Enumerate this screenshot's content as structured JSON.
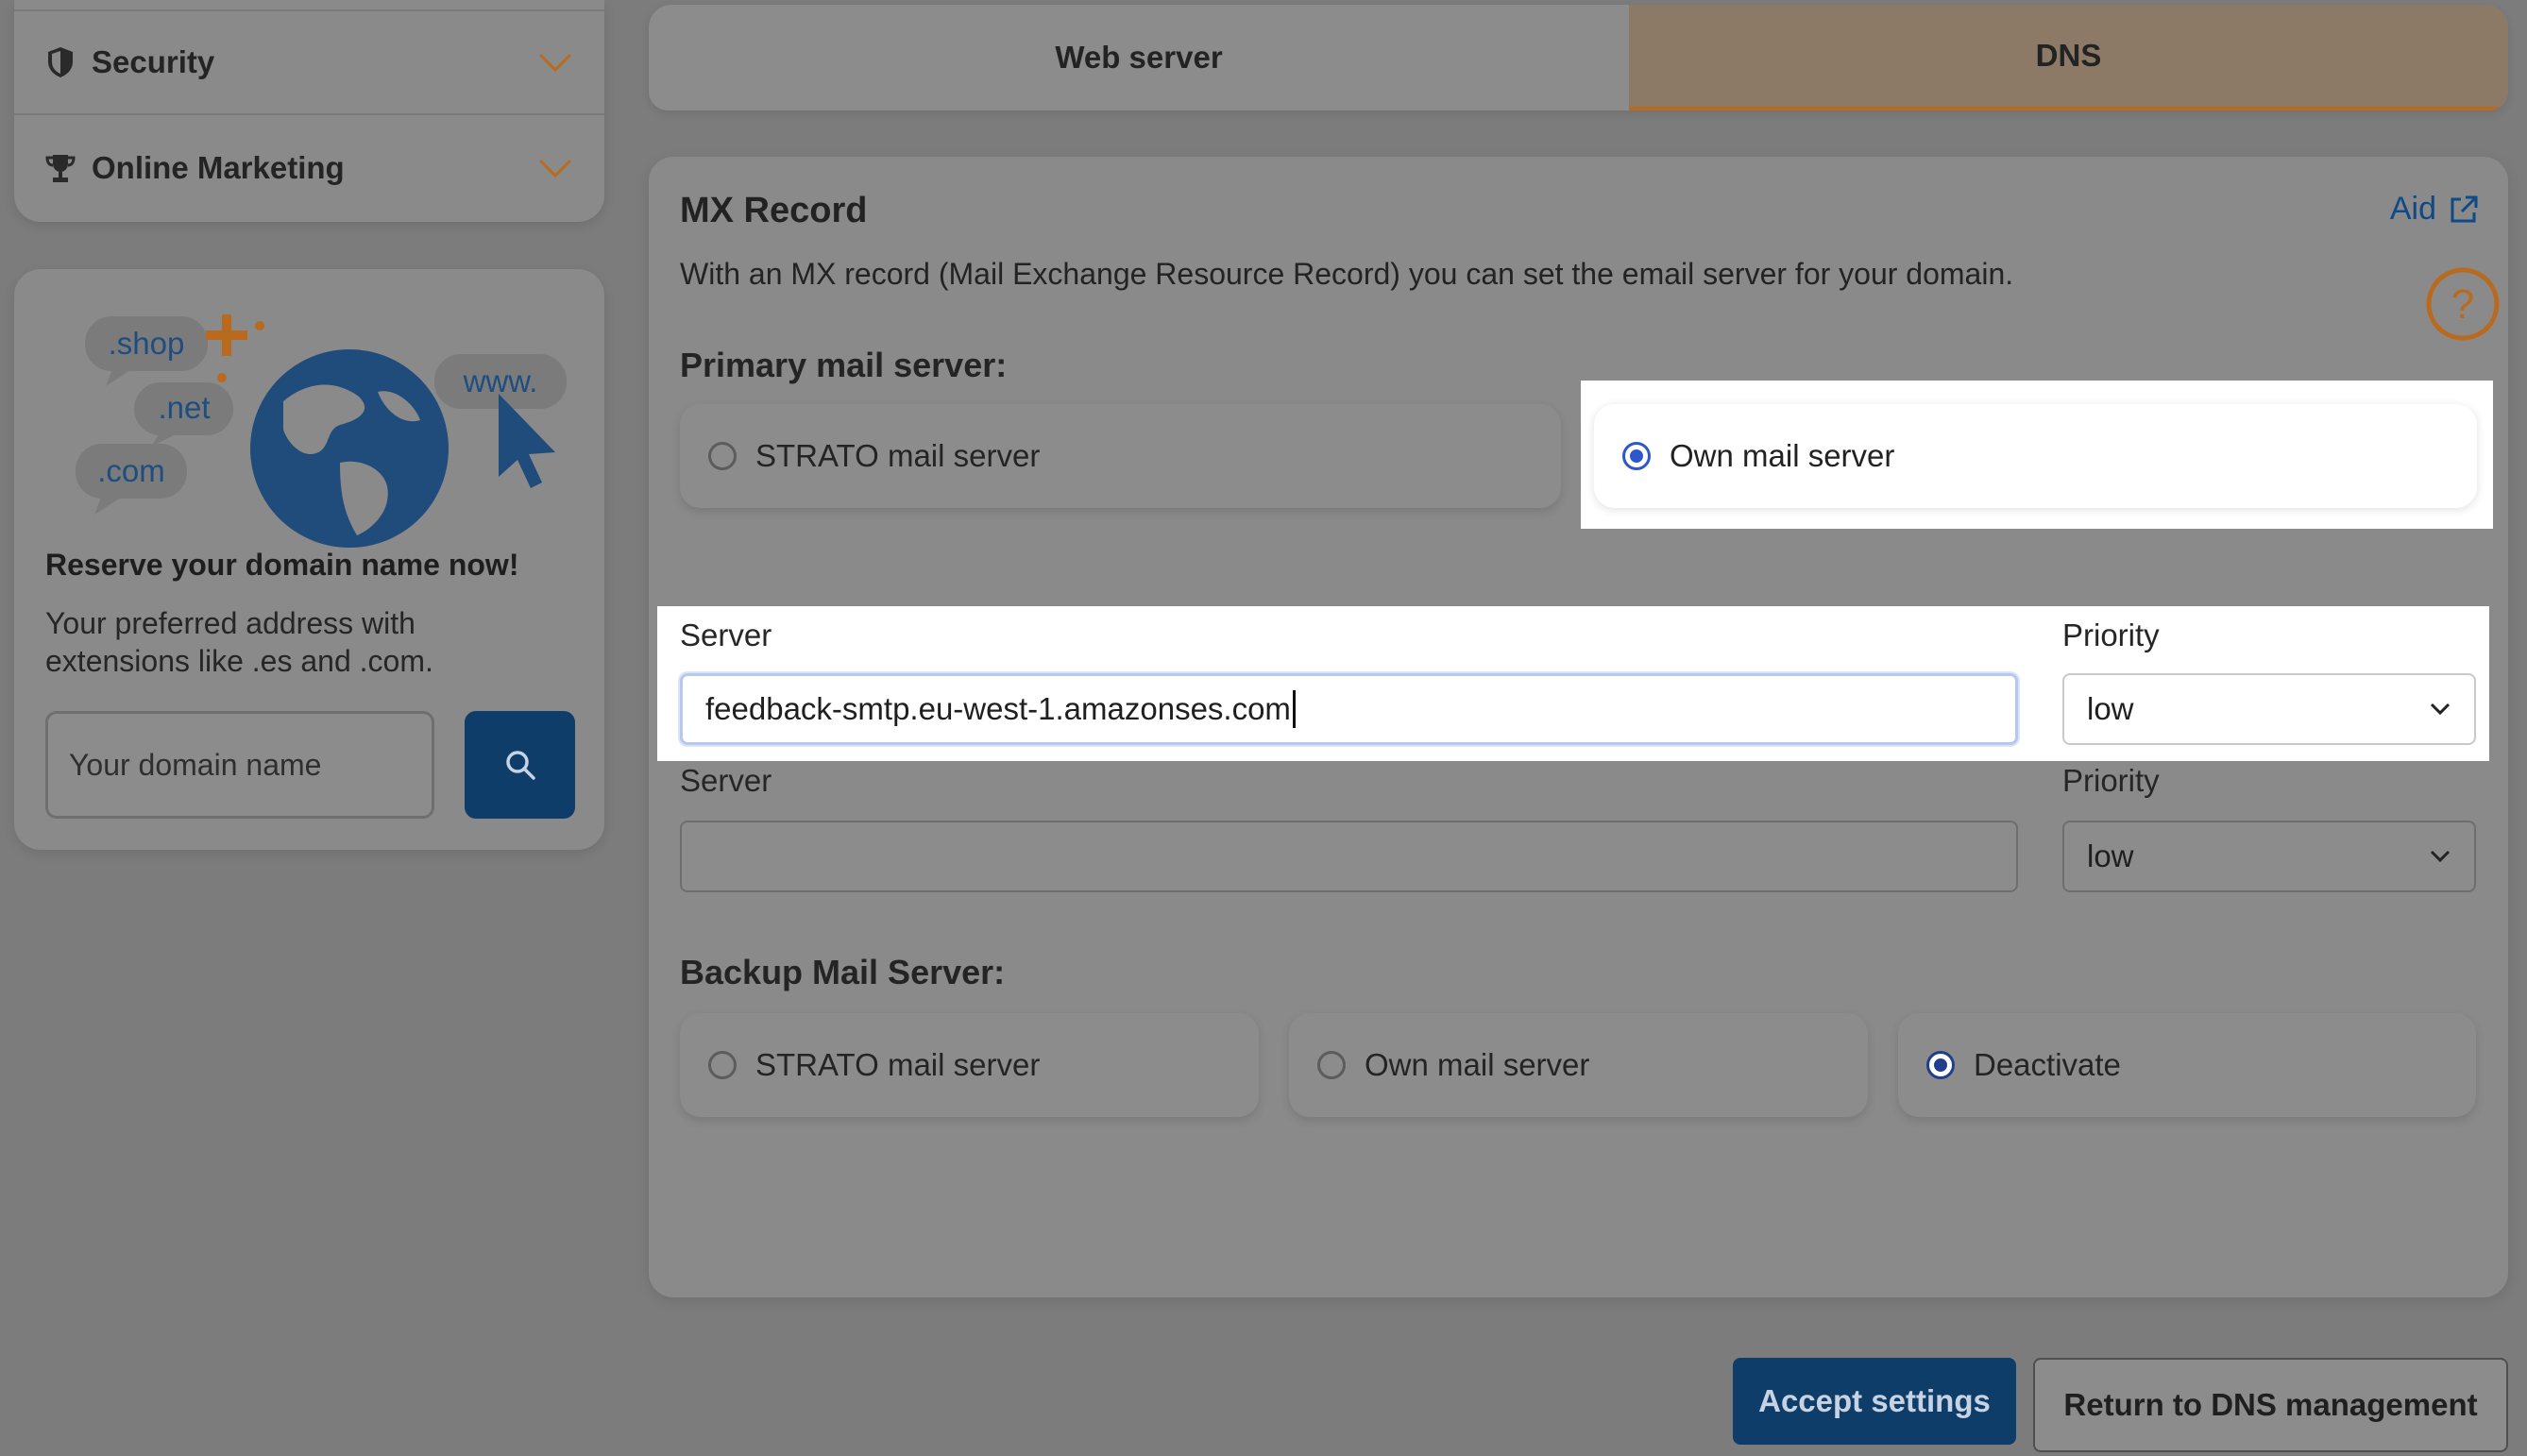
{
  "sidebar": {
    "items": [
      {
        "label": "Security",
        "icon": "shield-icon"
      },
      {
        "label": "Online Marketing",
        "icon": "trophy-icon"
      }
    ]
  },
  "promo": {
    "bubbles": [
      ".shop",
      ".net",
      ".com",
      "www."
    ],
    "title": "Reserve your domain name now!",
    "description": "Your preferred address with extensions like .es and .com.",
    "domain_placeholder": "Your domain name",
    "search_icon": "search-icon"
  },
  "tabs": [
    {
      "label": "Web server",
      "active": false
    },
    {
      "label": "DNS",
      "active": true
    }
  ],
  "mx": {
    "title": "MX Record",
    "aid_label": "Aid",
    "description": "With an MX record (Mail Exchange Resource Record) you can set the email server for your domain.",
    "primary": {
      "heading": "Primary mail server:",
      "options": [
        {
          "label": "STRATO mail server",
          "selected": false
        },
        {
          "label": "Own mail server",
          "selected": true
        }
      ]
    },
    "rows": [
      {
        "server_label": "Server",
        "server_value": "feedback-smtp.eu-west-1.amazonses.com",
        "priority_label": "Priority",
        "priority_value": "low"
      },
      {
        "server_label": "Server",
        "server_value": "",
        "priority_label": "Priority",
        "priority_value": "low"
      }
    ],
    "backup": {
      "heading": "Backup Mail Server:",
      "options": [
        {
          "label": "STRATO mail server",
          "selected": false
        },
        {
          "label": "Own mail server",
          "selected": false
        },
        {
          "label": "Deactivate",
          "selected": true
        }
      ]
    }
  },
  "buttons": {
    "accept": "Accept settings",
    "return": "Return to DNS management"
  },
  "colors": {
    "brand_blue": "#0f3d6a",
    "accent_orange": "#b86a1e",
    "radio_blue": "#2f57c9"
  }
}
